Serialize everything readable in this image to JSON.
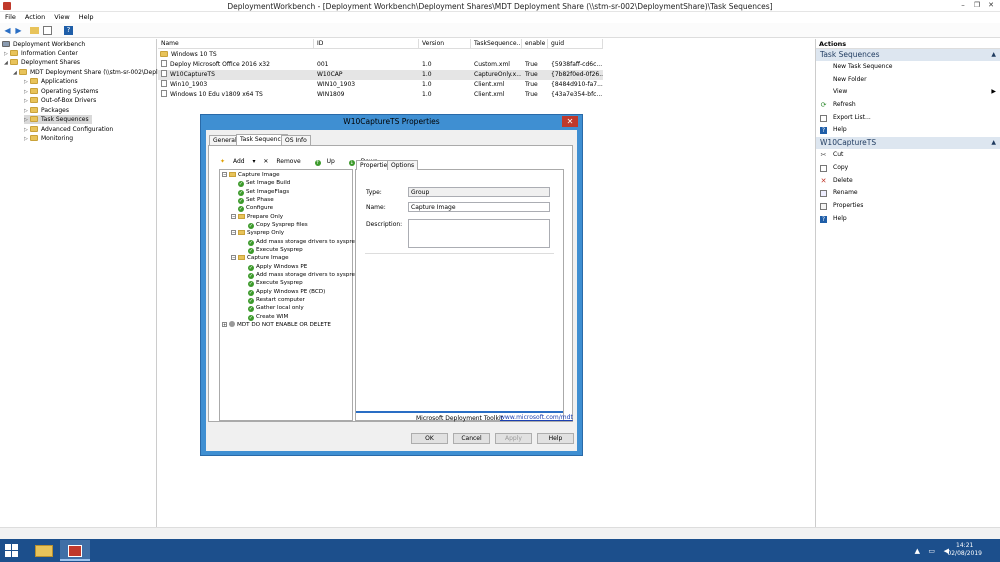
{
  "window": {
    "title": "DeploymentWorkbench - [Deployment Workbench\\Deployment Shares\\MDT Deployment Share (\\\\stm-sr-002\\DeploymentShare)\\Task Sequences]"
  },
  "menu": [
    "File",
    "Action",
    "View",
    "Help"
  ],
  "tree": [
    {
      "label": "Deployment Workbench"
    },
    {
      "label": "Information Center"
    },
    {
      "label": "Deployment Shares"
    },
    {
      "label": "MDT Deployment Share (\\\\stm-sr-002\\Depl"
    },
    {
      "label": "Applications"
    },
    {
      "label": "Operating Systems"
    },
    {
      "label": "Out-of-Box Drivers"
    },
    {
      "label": "Packages"
    },
    {
      "label": "Task Sequences"
    },
    {
      "label": "Advanced Configuration"
    },
    {
      "label": "Monitoring"
    }
  ],
  "list": {
    "columns": [
      "Name",
      "ID",
      "Version",
      "TaskSequence...",
      "enable",
      "guid"
    ],
    "rows": [
      {
        "name": "Windows 10 TS",
        "id": "",
        "version": "",
        "template": "",
        "enable": "",
        "guid": ""
      },
      {
        "name": "Deploy Microsoft Office 2016 x32",
        "id": "001",
        "version": "1.0",
        "template": "Custom.xml",
        "enable": "True",
        "guid": "{5938faff-cd6c..."
      },
      {
        "name": "W10CaptureTS",
        "id": "W10CAP",
        "version": "1.0",
        "template": "CaptureOnly.x...",
        "enable": "True",
        "guid": "{7b82f0ed-0f26..."
      },
      {
        "name": "Win10_1903",
        "id": "WIN10_1903",
        "version": "1.0",
        "template": "Client.xml",
        "enable": "True",
        "guid": "{8484d910-fa7..."
      },
      {
        "name": "Windows 10 Edu v1809 x64 TS",
        "id": "WIN1809",
        "version": "1.0",
        "template": "Client.xml",
        "enable": "True",
        "guid": "{43a7e354-bfc..."
      }
    ]
  },
  "actions": {
    "header": "Actions",
    "section1": "Task Sequences",
    "items1": [
      {
        "label": "New Task Sequence",
        "icon": "none"
      },
      {
        "label": "New Folder",
        "icon": "none"
      },
      {
        "label": "View",
        "icon": "none"
      },
      {
        "label": "Refresh",
        "icon": "refresh-icon"
      },
      {
        "label": "Export List...",
        "icon": "export-icon"
      },
      {
        "label": "Help",
        "icon": "help-icon"
      }
    ],
    "section2": "W10CaptureTS",
    "items2": [
      {
        "label": "Cut",
        "icon": "cut-icon"
      },
      {
        "label": "Copy",
        "icon": "copy-icon"
      },
      {
        "label": "Delete",
        "icon": "delete-icon"
      },
      {
        "label": "Rename",
        "icon": "rename-icon"
      },
      {
        "label": "Properties",
        "icon": "properties-icon"
      },
      {
        "label": "Help",
        "icon": "help-icon"
      }
    ]
  },
  "dialog": {
    "title": "W10CaptureTS Properties",
    "tabs": [
      "General",
      "Task Sequence",
      "OS Info"
    ],
    "toolbar": {
      "add": "Add",
      "remove": "Remove",
      "up": "Up",
      "down": "Down"
    },
    "steps": [
      {
        "label": "Capture Image",
        "kind": "group",
        "level": 0
      },
      {
        "label": "Set Image Build",
        "kind": "ok",
        "level": 1
      },
      {
        "label": "Set ImageFlags",
        "kind": "ok",
        "level": 1
      },
      {
        "label": "Set Phase",
        "kind": "ok",
        "level": 1
      },
      {
        "label": "Configure",
        "kind": "ok",
        "level": 1
      },
      {
        "label": "Prepare Only",
        "kind": "group",
        "level": 1
      },
      {
        "label": "Copy Sysprep files",
        "kind": "ok",
        "level": 2
      },
      {
        "label": "Sysprep Only",
        "kind": "group",
        "level": 1
      },
      {
        "label": "Add mass storage drivers to sysprep.ir",
        "kind": "ok",
        "level": 2
      },
      {
        "label": "Execute Sysprep",
        "kind": "ok",
        "level": 2
      },
      {
        "label": "Capture Image",
        "kind": "group",
        "level": 1
      },
      {
        "label": "Apply Windows PE",
        "kind": "ok",
        "level": 2
      },
      {
        "label": "Add mass storage drivers to sysprep.ir",
        "kind": "ok",
        "level": 2
      },
      {
        "label": "Execute Sysprep",
        "kind": "ok",
        "level": 2
      },
      {
        "label": "Apply Windows PE (BCD)",
        "kind": "ok",
        "level": 2
      },
      {
        "label": "Restart computer",
        "kind": "ok",
        "level": 2
      },
      {
        "label": "Gather local only",
        "kind": "ok",
        "level": 2
      },
      {
        "label": "Create WIM",
        "kind": "ok",
        "level": 2
      },
      {
        "label": "MDT DO NOT ENABLE OR DELETE",
        "kind": "disabled",
        "level": 0
      }
    ],
    "props_tabs": [
      "Properties",
      "Options"
    ],
    "type_label": "Type:",
    "type_value": "Group",
    "name_label": "Name:",
    "name_value": "Capture Image",
    "desc_label": "Description:",
    "footer_text": "Microsoft Deployment Toolkit",
    "footer_link": "www.microsoft.com/mdt",
    "buttons": {
      "ok": "OK",
      "cancel": "Cancel",
      "apply": "Apply",
      "help": "Help"
    }
  },
  "taskbar": {
    "time": "14:21",
    "date": "02/08/2019"
  }
}
